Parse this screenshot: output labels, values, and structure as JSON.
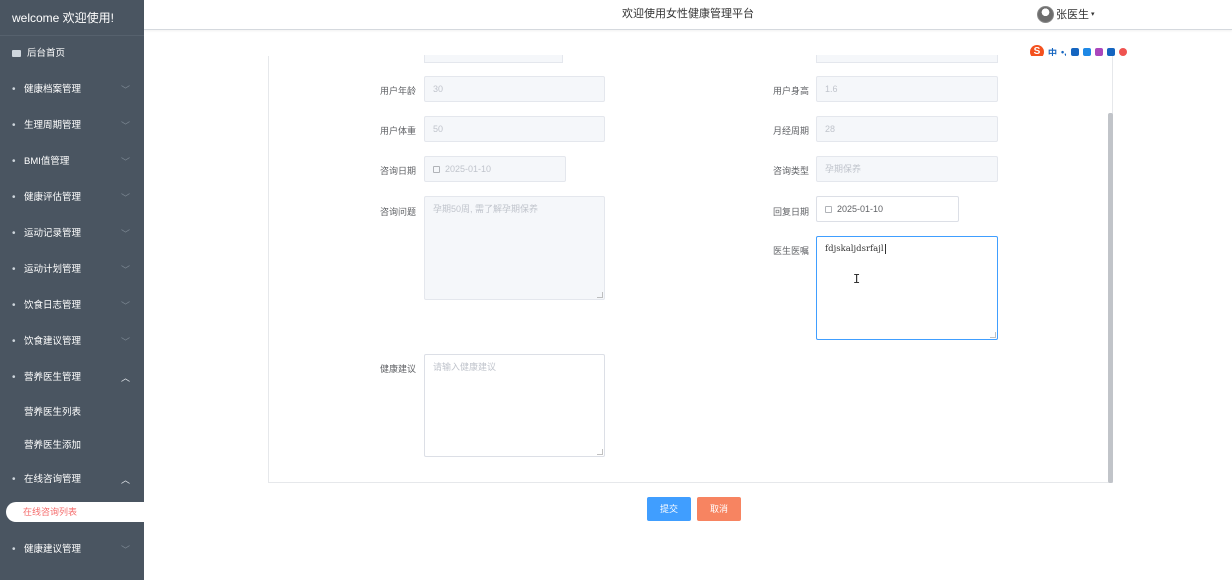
{
  "sidebar": {
    "brand": "welcome 欢迎使用!",
    "home": "后台首页",
    "menus": [
      {
        "label": "健康档案管理",
        "expanded": false
      },
      {
        "label": "生理周期管理",
        "expanded": false
      },
      {
        "label": "BMI值管理",
        "expanded": false
      },
      {
        "label": "健康评估管理",
        "expanded": false
      },
      {
        "label": "运动记录管理",
        "expanded": false
      },
      {
        "label": "运动计划管理",
        "expanded": false
      },
      {
        "label": "饮食日志管理",
        "expanded": false
      },
      {
        "label": "饮食建议管理",
        "expanded": false
      }
    ],
    "nutrition": {
      "label": "营养医生管理",
      "subs": [
        "营养医生列表",
        "营养医生添加"
      ]
    },
    "consult": {
      "label": "在线咨询管理",
      "active_sub": "在线咨询列表"
    },
    "advice": {
      "label": "健康建议管理"
    },
    "chev_down": "﹀",
    "chev_up": "︿",
    "dot": "•"
  },
  "header": {
    "title": "欢迎使用女性健康管理平台",
    "user": "张医生",
    "caret": "▾"
  },
  "ime": {
    "s": "S",
    "mode": "中",
    "punct": "•,"
  },
  "form": {
    "age": {
      "label": "用户年龄",
      "value": "30"
    },
    "height": {
      "label": "用户身高",
      "value": "1.6"
    },
    "weight": {
      "label": "用户体重",
      "value": "50"
    },
    "cycle": {
      "label": "月经周期",
      "value": "28"
    },
    "consult_date": {
      "label": "咨询日期",
      "value": "2025-01-10"
    },
    "consult_type": {
      "label": "咨询类型",
      "value": "孕期保养"
    },
    "question": {
      "label": "咨询问题",
      "value": "孕期50周, 需了解孕期保养"
    },
    "reply_date": {
      "label": "回复日期",
      "value": "2025-01-10"
    },
    "doctor_advice": {
      "label": "医生医嘱",
      "value": "fdjskaljdsrfajl"
    },
    "health_advice": {
      "label": "健康建议",
      "placeholder": "请输入健康建议"
    }
  },
  "buttons": {
    "submit": "提交",
    "cancel": "取消"
  },
  "colors": {
    "sidebar_bg": "#4a5561",
    "primary": "#409eff",
    "cancel": "#f78461",
    "active_text": "#f56c6c"
  }
}
